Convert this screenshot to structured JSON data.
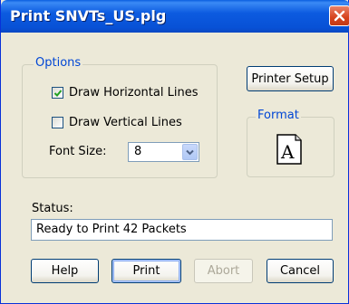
{
  "window": {
    "title": "Print SNVTs_US.plg"
  },
  "options": {
    "group_label": "Options",
    "draw_horizontal": {
      "label": "Draw Horizontal Lines",
      "checked": true
    },
    "draw_vertical": {
      "label": "Draw Vertical Lines",
      "checked": false
    },
    "font_size": {
      "label": "Font Size:",
      "value": "8"
    }
  },
  "printer_setup_label": "Printer Setup",
  "format": {
    "group_label": "Format",
    "icon": "font-a-icon",
    "glyph": "A"
  },
  "status": {
    "label": "Status:",
    "value": "Ready to Print 42 Packets"
  },
  "buttons": {
    "help": "Help",
    "print": "Print",
    "abort": "Abort",
    "cancel": "Cancel"
  },
  "colors": {
    "title_bar": "#0851d6",
    "dialog_bg": "#ece9d8",
    "group_label": "#0046d5",
    "close_button": "#d6421c"
  }
}
